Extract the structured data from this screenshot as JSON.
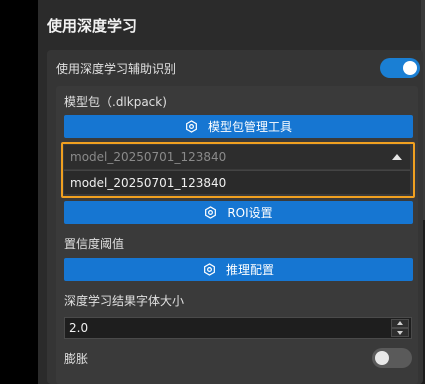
{
  "section": {
    "title": "使用深度学习"
  },
  "assist": {
    "label": "使用深度学习辅助识别",
    "enabled": true
  },
  "model_package": {
    "label": "模型包（.dlkpack)",
    "manage_button": "模型包管理工具",
    "selected_value": "model_20250701_123840",
    "options": [
      "model_20250701_123840"
    ]
  },
  "roi": {
    "button": "ROI设置"
  },
  "confidence": {
    "label": "置信度阈值",
    "button": "推理配置"
  },
  "font_size": {
    "label": "深度学习结果字体大小",
    "value": "2.0"
  },
  "dilate": {
    "label": "膨胀",
    "enabled": false
  },
  "colors": {
    "accent": "#1676d2",
    "highlight": "#f0a020"
  },
  "icons": {
    "settings": "hexagon-gear-icon",
    "dropdown": "triangle-up-icon"
  }
}
